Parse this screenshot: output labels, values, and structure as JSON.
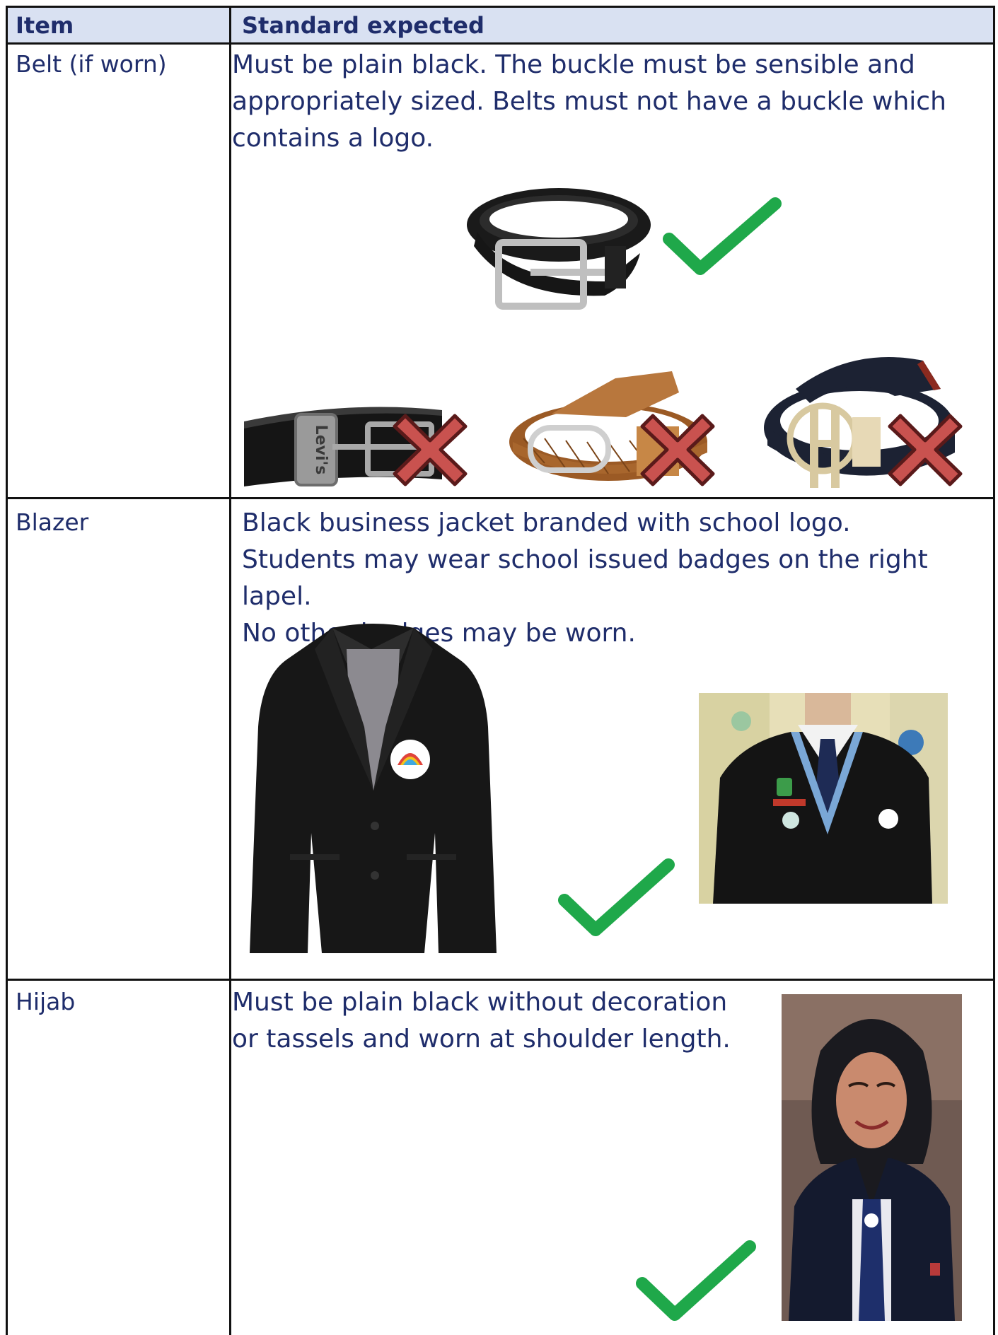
{
  "table": {
    "headers": {
      "item": "Item",
      "standard": "Standard expected"
    },
    "rows": [
      {
        "item": "Belt (if worn)",
        "standard": "Must be plain black. The buckle must be sensible and\nappropriately sized. Belts must not have a buckle which\ncontains a logo.",
        "images": {
          "acceptable": "plain-black-belt",
          "not_acceptable": [
            "branded-belt-levis",
            "woven-tan-belt",
            "logo-buckle-belt"
          ],
          "belt_brand_text": "Levi's"
        }
      },
      {
        "item": "Blazer",
        "standard": "Black business jacket branded with school logo.\nStudents may wear school issued badges on the right lapel.\nNo other badges may be worn.",
        "images": {
          "acceptable": [
            "black-blazer-with-logo",
            "student-wearing-blazer"
          ]
        }
      },
      {
        "item": "Hijab",
        "standard": "Must be plain black without decoration\nor tassels and worn at shoulder length.",
        "images": {
          "acceptable": "student-wearing-black-hijab"
        }
      }
    ]
  },
  "icons": {
    "tick": "check-mark-icon",
    "cross": "cross-mark-icon"
  },
  "colors": {
    "text": "#1f2d6b",
    "header_background": "#d9e1f2",
    "tick": "#1fa84a",
    "cross_fill": "#c9524f",
    "cross_stroke": "#5a1a1a"
  }
}
